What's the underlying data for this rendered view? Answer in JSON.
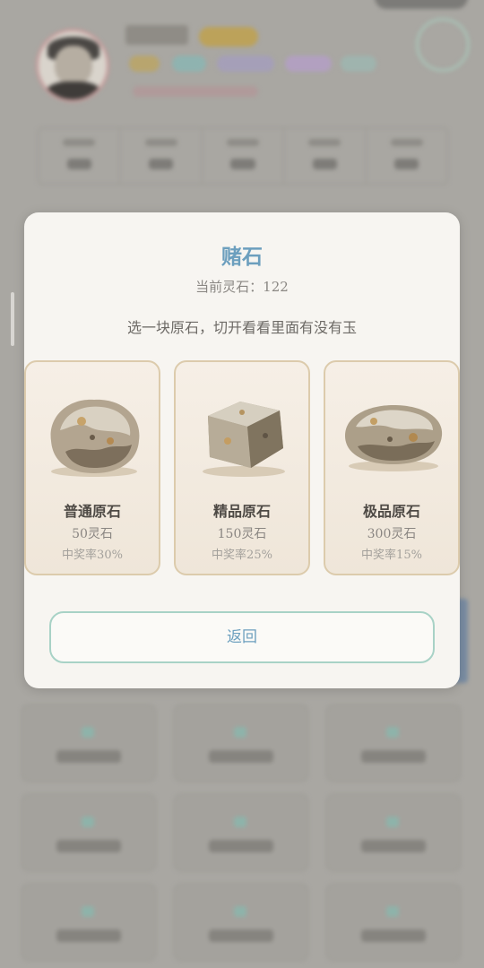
{
  "modal": {
    "title": "赌石",
    "balance": "当前灵石：122",
    "description": "选一块原石，切开看看里面有没有玉",
    "back_label": "返回"
  },
  "stones": [
    {
      "name": "普通原石",
      "price": "50灵石",
      "rate": "中奖率30%",
      "shape": "round"
    },
    {
      "name": "精品原石",
      "price": "150灵石",
      "rate": "中奖率25%",
      "shape": "cube"
    },
    {
      "name": "极品原石",
      "price": "300灵石",
      "rate": "中奖率15%",
      "shape": "oval"
    }
  ],
  "colors": {
    "accent": "#6c9fbe",
    "card_border": "#dccbac",
    "button_border": "#a8d2c6",
    "overlay": "#a9a7a2"
  }
}
